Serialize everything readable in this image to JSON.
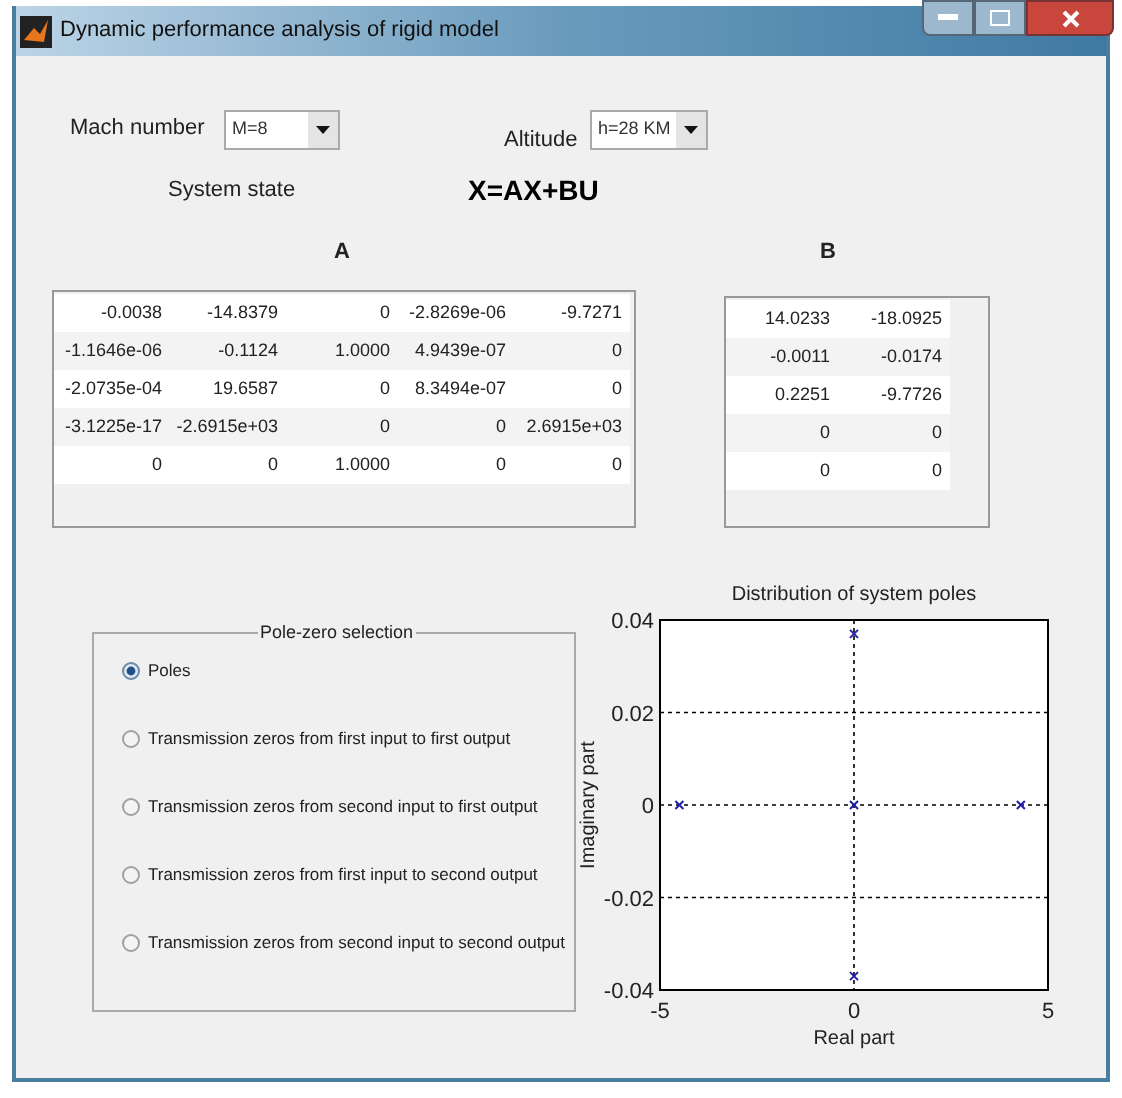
{
  "window": {
    "title": "Dynamic performance analysis of rigid model"
  },
  "mach": {
    "label": "Mach number",
    "value": "M=8"
  },
  "altitude": {
    "label": "Altitude",
    "value": "h=28 KM"
  },
  "system_state": {
    "label": "System state",
    "equation": "X=AX+BU"
  },
  "matrix_a": {
    "title": "A",
    "rows": [
      [
        "-0.0038",
        "-14.8379",
        "0",
        "-2.8269e-06",
        "-9.7271"
      ],
      [
        "-1.1646e-06",
        "-0.1124",
        "1.0000",
        "4.9439e-07",
        "0"
      ],
      [
        "-2.0735e-04",
        "19.6587",
        "0",
        "8.3494e-07",
        "0"
      ],
      [
        "-3.1225e-17",
        "-2.6915e+03",
        "0",
        "0",
        "2.6915e+03"
      ],
      [
        "0",
        "0",
        "1.0000",
        "0",
        "0"
      ]
    ]
  },
  "matrix_b": {
    "title": "B",
    "rows": [
      [
        "14.0233",
        "-18.0925"
      ],
      [
        "-0.0011",
        "-0.0174"
      ],
      [
        "0.2251",
        "-9.7726"
      ],
      [
        "0",
        "0"
      ],
      [
        "0",
        "0"
      ]
    ]
  },
  "pole_zero_selection": {
    "title": "Pole-zero selection",
    "options": [
      {
        "label": "Poles",
        "selected": true
      },
      {
        "label": "Transmission zeros from first input to first output",
        "selected": false
      },
      {
        "label": "Transmission zeros from second input to first output",
        "selected": false
      },
      {
        "label": "Transmission zeros from first input to second output",
        "selected": false
      },
      {
        "label": "Transmission zeros from second input to second output",
        "selected": false
      }
    ]
  },
  "plot": {
    "chart_data": {
      "type": "scatter",
      "grid": true,
      "title": "Distribution of system poles",
      "xlabel": "Real part",
      "ylabel": "Imaginary part",
      "xlim": [
        -5,
        5
      ],
      "ylim": [
        -0.04,
        0.04
      ],
      "xticks": [
        -5,
        0,
        5
      ],
      "yticks": [
        -0.04,
        -0.02,
        0,
        0.02,
        0.04
      ],
      "x": [
        -4.5,
        0,
        0,
        0,
        4.3
      ],
      "series": [
        {
          "color": "#2020a0",
          "values": [
            0,
            0.037,
            0,
            -0.037,
            0
          ]
        }
      ]
    }
  }
}
